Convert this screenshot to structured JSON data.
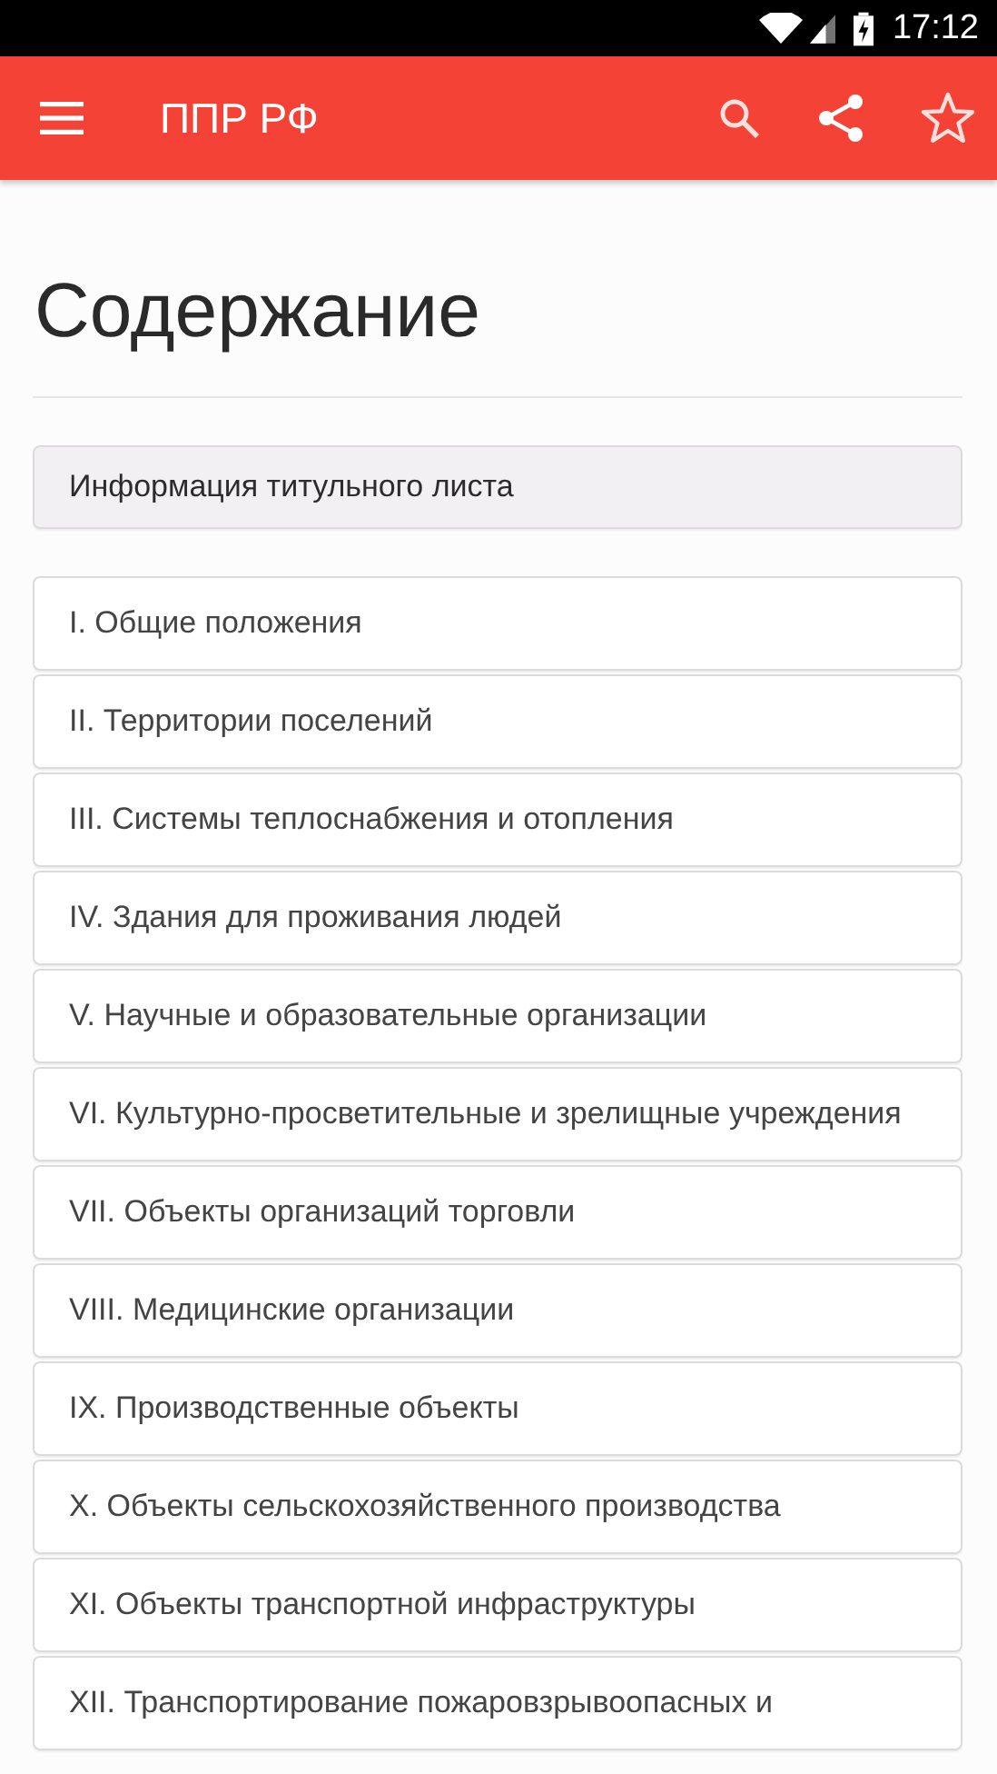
{
  "status_bar": {
    "time": "17:12"
  },
  "toolbar": {
    "title": "ППР РФ"
  },
  "heading": "Содержание",
  "items": [
    {
      "label": "Информация титульного листа",
      "selected": true
    },
    {
      "label": "I. Общие положения",
      "selected": false
    },
    {
      "label": "II. Территории поселений",
      "selected": false
    },
    {
      "label": "III. Системы теплоснабжения и отопления",
      "selected": false
    },
    {
      "label": "IV. Здания для проживания людей",
      "selected": false
    },
    {
      "label": "V. Научные и образовательные организации",
      "selected": false
    },
    {
      "label": "VI. Культурно-просветительные и зрелищные учреждения",
      "selected": false
    },
    {
      "label": "VII. Объекты организаций торговли",
      "selected": false
    },
    {
      "label": "VIII. Медицинские организации",
      "selected": false
    },
    {
      "label": "IX. Производственные объекты",
      "selected": false
    },
    {
      "label": "X. Объекты сельскохозяйственного производства",
      "selected": false
    },
    {
      "label": "XI. Объекты транспортной инфраструктуры",
      "selected": false
    },
    {
      "label": "XII. Транспортирование пожаровзрывоопасных и",
      "selected": false
    }
  ]
}
